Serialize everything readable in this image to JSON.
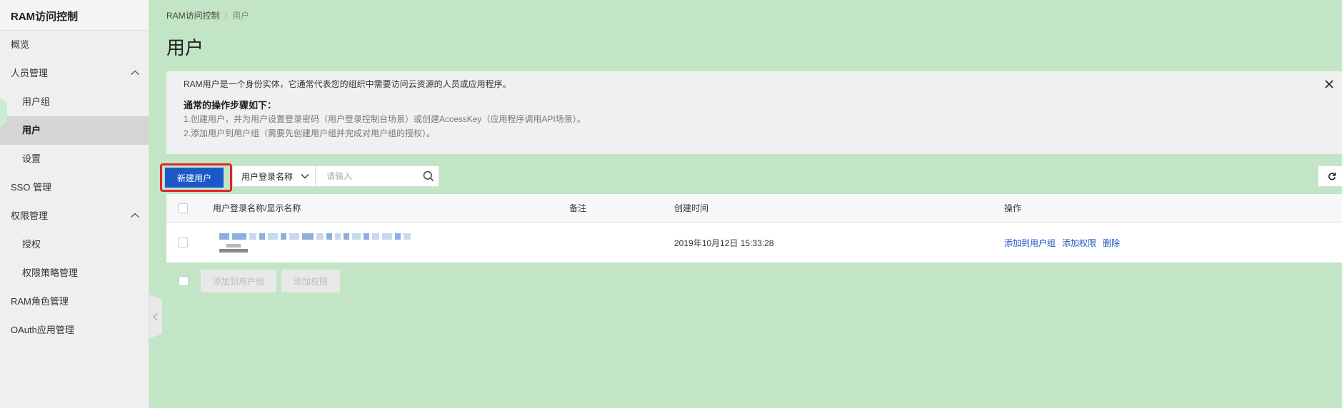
{
  "sidebar": {
    "title": "RAM访问控制",
    "items": [
      {
        "label": "概览",
        "child": false,
        "active": false,
        "expandable": false
      },
      {
        "label": "人员管理",
        "child": false,
        "active": false,
        "expandable": true
      },
      {
        "label": "用户组",
        "child": true,
        "active": false,
        "expandable": false
      },
      {
        "label": "用户",
        "child": true,
        "active": true,
        "expandable": false
      },
      {
        "label": "设置",
        "child": true,
        "active": false,
        "expandable": false
      },
      {
        "label": "SSO 管理",
        "child": false,
        "active": false,
        "expandable": false
      },
      {
        "label": "权限管理",
        "child": false,
        "active": false,
        "expandable": true
      },
      {
        "label": "授权",
        "child": true,
        "active": false,
        "expandable": false
      },
      {
        "label": "权限策略管理",
        "child": true,
        "active": false,
        "expandable": false
      },
      {
        "label": "RAM角色管理",
        "child": false,
        "active": false,
        "expandable": false
      },
      {
        "label": "OAuth应用管理",
        "child": false,
        "active": false,
        "expandable": false
      }
    ]
  },
  "breadcrumb": {
    "root": "RAM访问控制",
    "separator": "/",
    "current": "用户"
  },
  "page_title": "用户",
  "notice": {
    "intro": "RAM用户是一个身份实体，它通常代表您的组织中需要访问云资源的人员或应用程序。",
    "heading": "通常的操作步骤如下：",
    "steps": [
      "1.创建用户，并为用户设置登录密码（用户登录控制台场景）或创建AccessKey（应用程序调用API场景）。",
      "2.添加用户到用户组（需要先创建用户组并完成对用户组的授权）。"
    ]
  },
  "toolbar": {
    "new_user_label": "新建用户",
    "search_field_select": "用户登录名称",
    "search_placeholder": "请输入"
  },
  "table": {
    "headers": {
      "name": "用户登录名称/显示名称",
      "remark": "备注",
      "created": "创建时间",
      "actions": "操作"
    },
    "rows": [
      {
        "remark": "",
        "created": "2019年10月12日 15:33:28",
        "actions": [
          "添加到用户组",
          "添加权限",
          "删除"
        ]
      }
    ]
  },
  "footer": {
    "batch_add_group": "添加到用户组",
    "batch_add_permission": "添加权限"
  },
  "colors": {
    "primary": "#1b58c8",
    "highlight_border": "#e0242e",
    "background": "#c2e5c5",
    "sidebar_bg": "#efefef"
  }
}
